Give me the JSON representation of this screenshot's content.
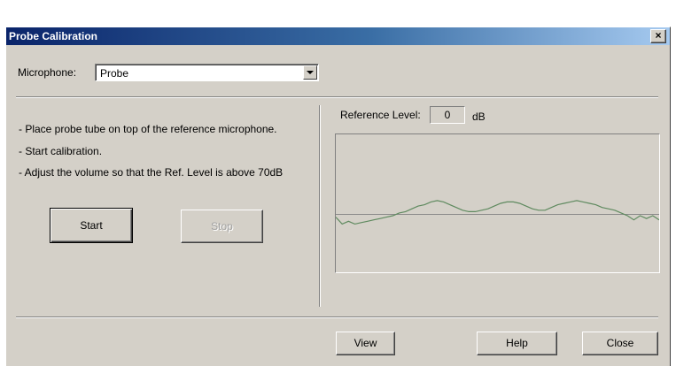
{
  "window": {
    "title": "Probe Calibration",
    "close_glyph": "×"
  },
  "microphone": {
    "label": "Microphone:",
    "selected": "Probe"
  },
  "instructions": [
    "- Place probe tube on top of the reference microphone.",
    "- Start calibration.",
    "- Adjust the volume so that the Ref. Level is above 70dB"
  ],
  "buttons": {
    "start": "Start",
    "stop": "Stop",
    "view": "View",
    "help": "Help",
    "close": "Close"
  },
  "reference": {
    "label": "Reference Level:",
    "value": "0",
    "unit": "dB"
  },
  "colors": {
    "titlebar_start": "#0a246a",
    "titlebar_end": "#a6caf0",
    "dialog_face": "#d4d0c8",
    "trace": "#5f8a5f",
    "reference_line": "#8a8a8a"
  },
  "icons": {
    "close": "close-icon",
    "dropdown": "chevron-down-icon"
  },
  "chart_data": {
    "type": "line",
    "reference_line": 0.58,
    "trace": [
      0.6,
      0.65,
      0.63,
      0.65,
      0.64,
      0.63,
      0.62,
      0.61,
      0.6,
      0.59,
      0.57,
      0.56,
      0.54,
      0.52,
      0.51,
      0.49,
      0.48,
      0.49,
      0.51,
      0.53,
      0.55,
      0.56,
      0.56,
      0.55,
      0.54,
      0.52,
      0.5,
      0.49,
      0.49,
      0.5,
      0.52,
      0.54,
      0.55,
      0.55,
      0.53,
      0.51,
      0.5,
      0.49,
      0.48,
      0.49,
      0.5,
      0.51,
      0.53,
      0.54,
      0.55,
      0.57,
      0.59,
      0.62,
      0.59,
      0.61,
      0.59,
      0.62
    ]
  }
}
